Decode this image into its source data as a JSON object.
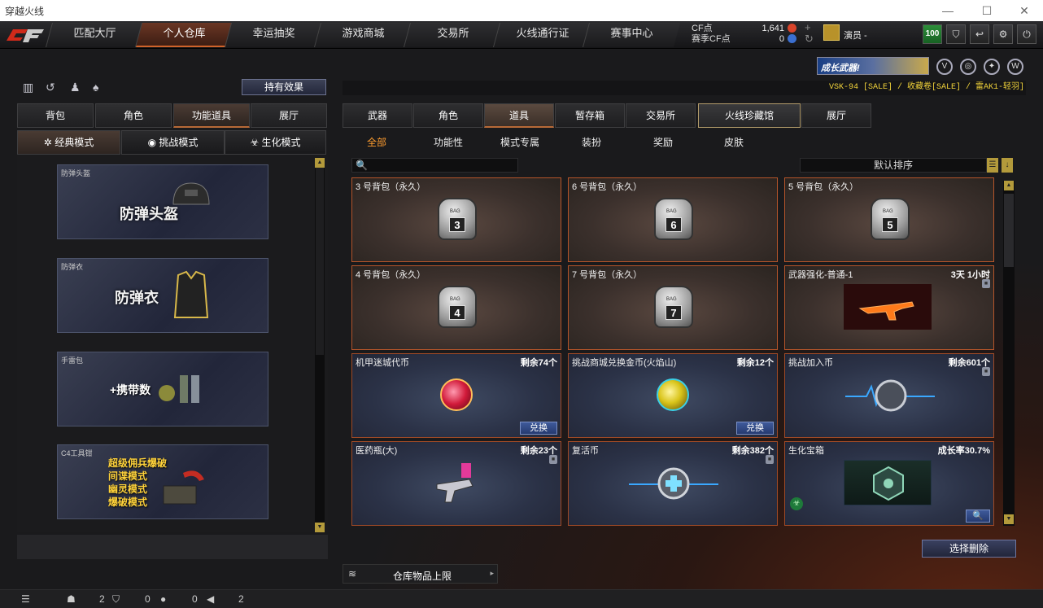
{
  "window": {
    "title": "穿越火线",
    "controls": [
      "—",
      "☐",
      "✕"
    ]
  },
  "nav": {
    "tabs": [
      "匹配大厅",
      "个人仓库",
      "幸运抽奖",
      "游戏商城",
      "交易所",
      "火线通行证",
      "赛事中心"
    ],
    "active": 1
  },
  "points": {
    "cf_label": "CF点",
    "cf_value": "1,641",
    "match_label": "赛季CF点",
    "match_value": "0"
  },
  "player": {
    "name": "演员 -",
    "rank_icon": "rank-badge",
    "level": "100"
  },
  "top_buttons": [
    "shield-icon",
    "back-icon",
    "gear-icon",
    "power-icon"
  ],
  "left": {
    "effect_button": "持有效果",
    "tabs": [
      "背包",
      "角色",
      "功能道具",
      "展厅"
    ],
    "active_tab": 2,
    "modes": [
      "经典模式",
      "挑战模式",
      "生化模式"
    ],
    "active_mode": 0,
    "cards": [
      {
        "caption": "防弹头盔",
        "title": "防弹头盔"
      },
      {
        "caption": "防弹衣",
        "title": "防弹衣"
      },
      {
        "caption": "手雷包",
        "title": "+携带数"
      },
      {
        "caption": "C4工具钳",
        "lines": [
          "超级佣兵爆破",
          "间谍模式",
          "幽灵模式",
          "爆破模式"
        ]
      }
    ]
  },
  "announce": {
    "banner": "成长武器!",
    "marquee": "VSK-94 [SALE] / 收藏卷[SALE] / 雷AK1-轻羽]"
  },
  "right": {
    "tabs": [
      "武器",
      "角色",
      "道具",
      "暂存箱",
      "交易所",
      "火线珍藏馆",
      "展厅"
    ],
    "active_tab": 2,
    "subtabs": [
      "全部",
      "功能性",
      "模式专属",
      "装扮",
      "奖励",
      "皮肤"
    ],
    "active_subtab": 0,
    "search_icon": "🔍",
    "sort_label": "默认排序",
    "items": [
      {
        "name": "3 号背包（永久）",
        "bag": "3"
      },
      {
        "name": "6 号背包（永久）",
        "bag": "6"
      },
      {
        "name": "5 号背包（永久）",
        "bag": "5"
      },
      {
        "name": "4 号背包（永久）",
        "bag": "4"
      },
      {
        "name": "7 号背包（永久）",
        "bag": "7"
      },
      {
        "name": "武器强化-普通-1",
        "remain": "3天 1小时"
      },
      {
        "name": "机甲迷城代币",
        "remain": "剩余74个",
        "action": "兑换"
      },
      {
        "name": "挑战商城兑换金币(火焰山)",
        "remain": "剩余12个",
        "action": "兑换"
      },
      {
        "name": "挑战加入币",
        "remain": "剩余601个"
      },
      {
        "name": "医药瓶(大)",
        "remain": "剩余23个"
      },
      {
        "name": "复活币",
        "remain": "剩余382个"
      },
      {
        "name": "生化宝箱",
        "remain": "成长率30.7%"
      }
    ],
    "delete_button": "选择删除",
    "limit_label": "仓库物品上限"
  },
  "statusbar": {
    "a": "2",
    "b": "0",
    "c": "0",
    "d": "2"
  }
}
